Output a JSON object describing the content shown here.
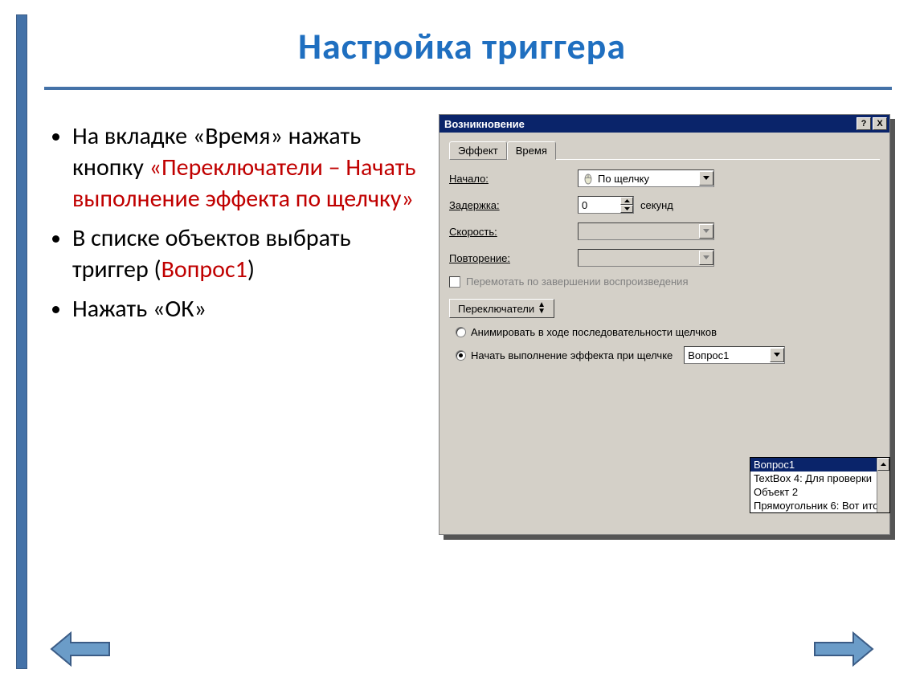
{
  "slide": {
    "title": "Настройка триггера",
    "bullets": [
      {
        "pre": "На вкладке «Время» нажать кнопку ",
        "hl": "«Переключатели – Начать выполнение эффекта по щелчку»",
        "post": ""
      },
      {
        "pre": "В списке объектов выбрать триггер (",
        "hl": "Вопрос1",
        "post": ")"
      },
      {
        "pre": "Нажать «ОК»",
        "hl": "",
        "post": ""
      }
    ]
  },
  "dialog": {
    "title": "Возникновение",
    "help_btn": "?",
    "close_btn": "X",
    "tabs": {
      "effect": "Эффект",
      "time": "Время"
    },
    "labels": {
      "start": "Начало:",
      "delay": "Задержка:",
      "speed": "Скорость:",
      "repeat": "Повторение:",
      "seconds": "секунд"
    },
    "start_value": "По щелчку",
    "delay_value": "0",
    "rewind_label": "Перемотать по завершении воспроизведения",
    "switches_btn": "Переключатели",
    "radio1": "Анимировать в ходе последовательности щелчков",
    "radio2": "Начать выполнение эффекта при щелчке",
    "trigger_selected": "Вопрос1",
    "dropdown_items": [
      "Вопрос1",
      "TextBox 4: Для проверки ",
      "Объект 2",
      "Прямоугольник 6: Вот ито"
    ]
  },
  "nav": {
    "prev": "previous",
    "next": "next"
  }
}
